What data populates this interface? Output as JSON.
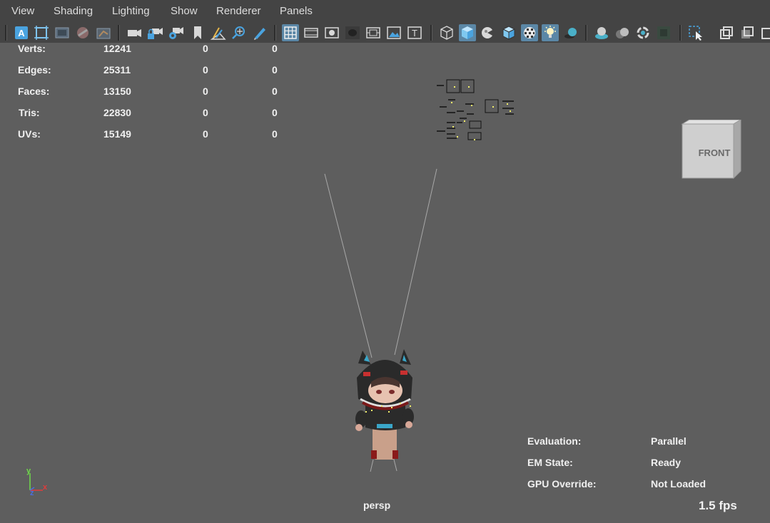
{
  "menu": {
    "items": [
      {
        "label": "View"
      },
      {
        "label": "Shading"
      },
      {
        "label": "Lighting"
      },
      {
        "label": "Show"
      },
      {
        "label": "Renderer"
      },
      {
        "label": "Panels"
      }
    ]
  },
  "toolbar": {
    "icons": [
      "select-camera-icon",
      "camera-attributes-icon",
      "film-gate-icon",
      "resolution-gate-icon",
      "grease-pencil-icon",
      "camera-icon",
      "lock-camera-icon",
      "camera-settings-icon",
      "bookmark-icon",
      "image-plane-icon",
      "2d-pan-zoom-icon",
      "grease-pencil-tool-icon",
      "grid-icon",
      "film-gate-toggle-icon",
      "resolution-gate-toggle-icon",
      "gate-mask-icon",
      "field-chart-icon",
      "safe-action-icon",
      "safe-title-icon",
      "wireframe-icon",
      "smooth-shade-icon",
      "default-material-icon",
      "wireframe-on-shaded-icon",
      "textured-icon",
      "use-all-lights-icon",
      "shadows-icon",
      "screen-space-ao-icon",
      "motion-blur-icon",
      "anti-aliasing-icon",
      "depth-of-field-icon",
      "isolate-select-icon",
      "xray-icon",
      "xray-joints-icon",
      "xray-active-icon"
    ]
  },
  "stats": {
    "rows": [
      {
        "label": "Verts:",
        "total": "12241",
        "selected": "0",
        "components": "0"
      },
      {
        "label": "Edges:",
        "total": "25311",
        "selected": "0",
        "components": "0"
      },
      {
        "label": "Faces:",
        "total": "13150",
        "selected": "0",
        "components": "0"
      },
      {
        "label": "Tris:",
        "total": "22830",
        "selected": "0",
        "components": "0"
      },
      {
        "label": "UVs:",
        "total": "15149",
        "selected": "0",
        "components": "0"
      }
    ]
  },
  "status": {
    "rows": [
      {
        "label": "Evaluation:",
        "value": "Parallel"
      },
      {
        "label": "EM State:",
        "value": "Ready"
      },
      {
        "label": "GPU Override:",
        "value": "Not Loaded"
      }
    ]
  },
  "viewport": {
    "camera_name": "persp",
    "fps": "1.5 fps",
    "viewcube_label": "FRONT",
    "axis": {
      "x": "x",
      "y": "y",
      "z": "z"
    }
  },
  "colors": {
    "menubar_bg": "#444444",
    "viewport_bg": "#5e5e5e",
    "active_button": "#5b87a6",
    "axis_x": "#e23b3b",
    "axis_y": "#6fd94a",
    "axis_z": "#4a6ee0"
  }
}
